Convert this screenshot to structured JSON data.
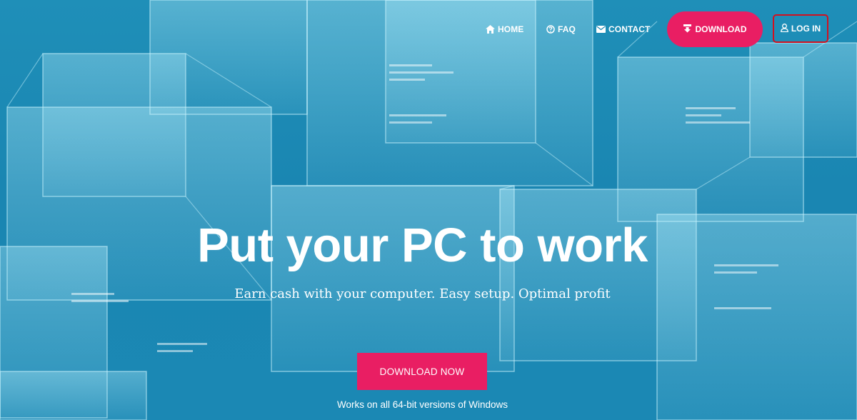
{
  "nav": {
    "home_label": "HOME",
    "faq_label": "FAQ",
    "contact_label": "CONTACT",
    "download_label": "DOWNLOAD",
    "login_label": "LOG IN"
  },
  "hero": {
    "title": "Put your PC to work",
    "subtitle": "Earn cash with your computer. Easy setup. Optimal profit",
    "cta_label": "DOWNLOAD NOW",
    "note": "Works on all 64-bit versions of Windows"
  },
  "colors": {
    "accent": "#e91e63",
    "background": "#1a86b2",
    "login_border": "#d2101f"
  },
  "icons": {
    "home": "home-icon",
    "faq": "question-circle-icon",
    "contact": "envelope-icon",
    "download": "download-icon",
    "login": "user-icon"
  }
}
